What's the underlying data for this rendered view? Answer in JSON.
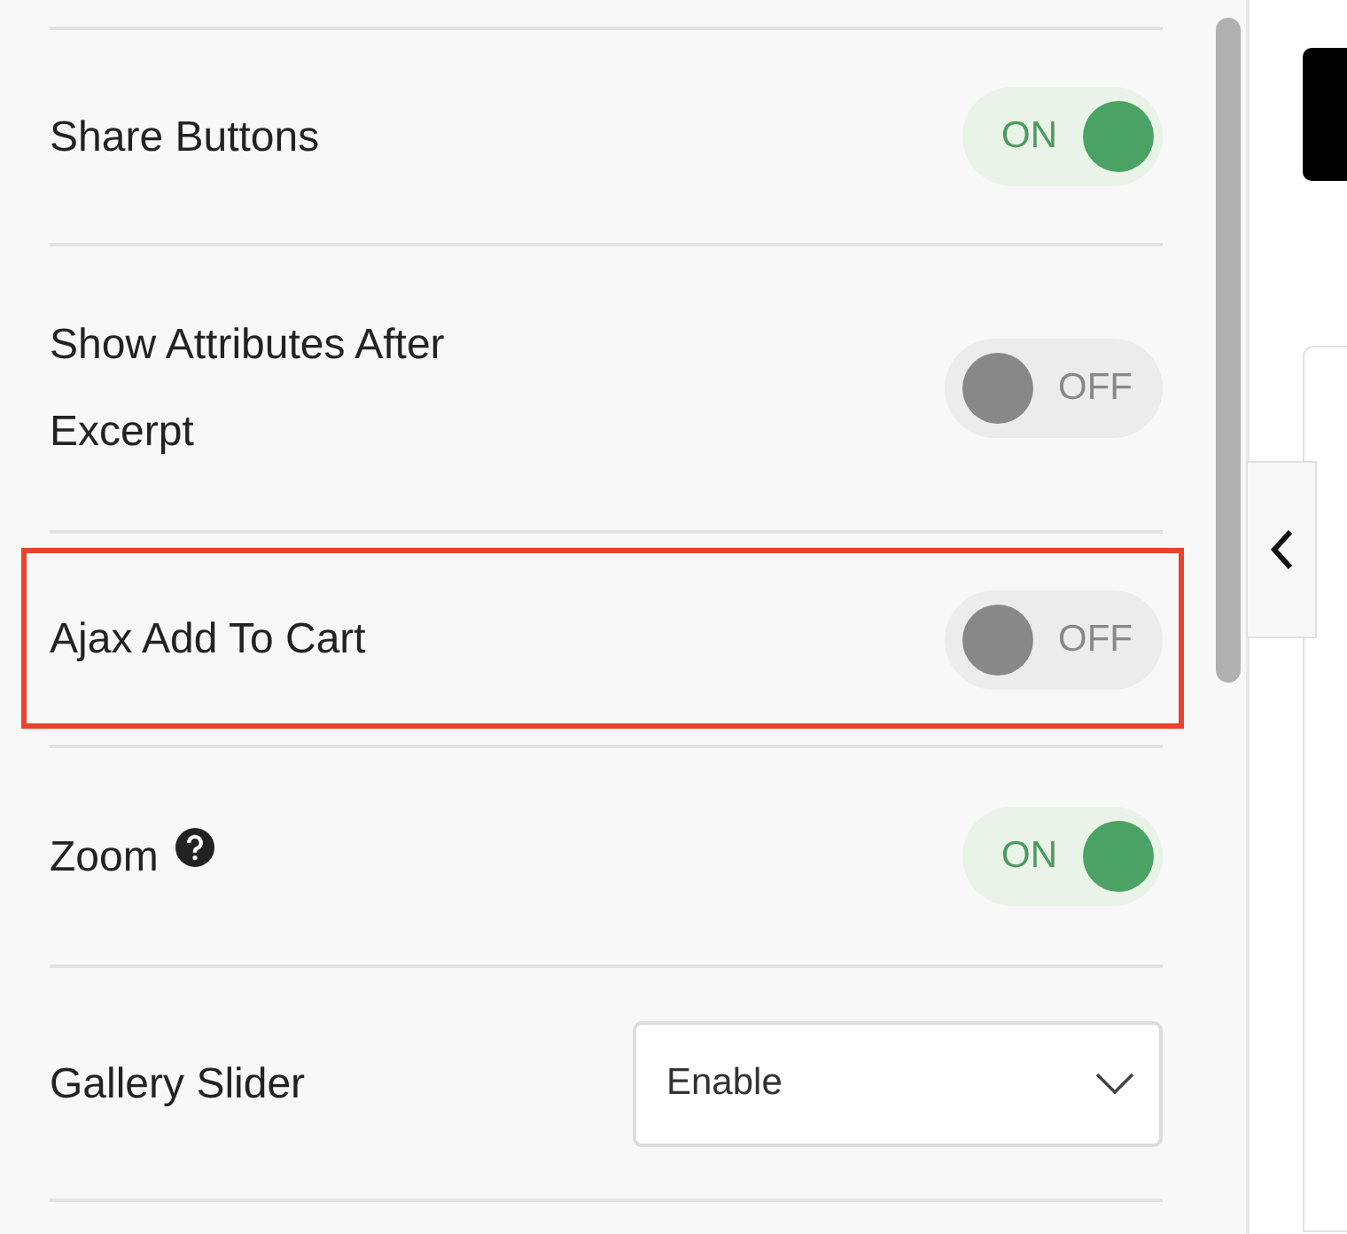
{
  "settings": [
    {
      "kind": "toggle",
      "label": "Share Buttons",
      "on": true,
      "state_text": "ON",
      "highlighted": false,
      "has_help": false
    },
    {
      "kind": "toggle",
      "label": "Show Attributes After Excerpt",
      "on": false,
      "state_text": "OFF",
      "highlighted": false,
      "has_help": false
    },
    {
      "kind": "toggle",
      "label": "Ajax Add To Cart",
      "on": false,
      "state_text": "OFF",
      "highlighted": true,
      "has_help": false
    },
    {
      "kind": "toggle",
      "label": "Zoom",
      "on": true,
      "state_text": "ON",
      "highlighted": false,
      "has_help": true
    },
    {
      "kind": "select",
      "label": "Gallery Slider",
      "value": "Enable",
      "highlighted": false,
      "has_help": false
    }
  ]
}
